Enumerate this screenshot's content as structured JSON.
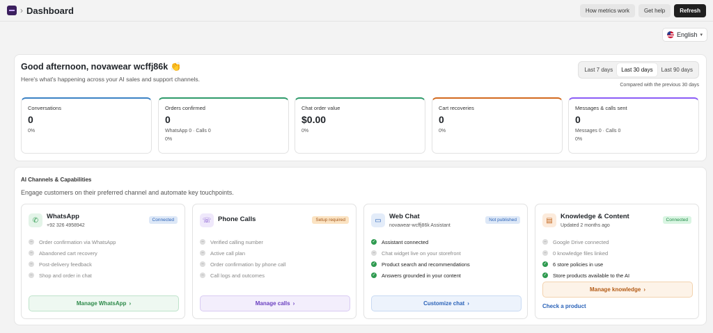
{
  "header": {
    "page_title": "Dashboard",
    "buttons": {
      "how": "How metrics work",
      "help": "Get help",
      "refresh": "Refresh"
    }
  },
  "language": {
    "label": "English"
  },
  "overview": {
    "greeting": "Good afternoon, novawear wcffj86k 👏",
    "subtitle": "Here's what's happening across your AI sales and support channels.",
    "ranges": [
      "Last 7 days",
      "Last 30 days",
      "Last 90 days"
    ],
    "active_range": "Last 30 days",
    "compared": "Compared with the previous 30 days",
    "metrics": [
      {
        "label": "Conversations",
        "value": "0",
        "sub1": "0%",
        "sub2": "",
        "color": "#3b82c4"
      },
      {
        "label": "Orders confirmed",
        "value": "0",
        "sub1": "WhatsApp 0 · Calls 0",
        "sub2": "0%",
        "color": "#2e9a6a"
      },
      {
        "label": "Chat order value",
        "value": "$0.00",
        "sub1": "0%",
        "sub2": "",
        "color": "#2e9a6a"
      },
      {
        "label": "Cart recoveries",
        "value": "0",
        "sub1": "0%",
        "sub2": "",
        "color": "#d2691e"
      },
      {
        "label": "Messages & calls sent",
        "value": "0",
        "sub1": "Messages 0 · Calls 0",
        "sub2": "0%",
        "color": "#8b5cf6"
      }
    ]
  },
  "channels": {
    "title": "AI Channels & Capabilities",
    "subtitle": "Engage customers on their preferred channel and automate key touchpoints.",
    "cards": [
      {
        "name": "WhatsApp",
        "sub": "+92 326 4958942",
        "badge": "Connected",
        "features": [
          {
            "text": "Order confirmation via WhatsApp",
            "on": false
          },
          {
            "text": "Abandoned cart recovery",
            "on": false
          },
          {
            "text": "Post-delivery feedback",
            "on": false
          },
          {
            "text": "Shop and order in chat",
            "on": false
          }
        ],
        "action": "Manage WhatsApp"
      },
      {
        "name": "Phone Calls",
        "sub": "",
        "badge": "Setup required",
        "features": [
          {
            "text": "Verified calling number",
            "on": false
          },
          {
            "text": "Active call plan",
            "on": false
          },
          {
            "text": "Order confirmation by phone call",
            "on": false
          },
          {
            "text": "Call logs and outcomes",
            "on": false
          }
        ],
        "action": "Manage calls"
      },
      {
        "name": "Web Chat",
        "sub": "novawear-wcffj86k Assistant",
        "badge": "Not published",
        "features": [
          {
            "text": "Assistant connected",
            "on": true
          },
          {
            "text": "Chat widget live on your storefront",
            "on": false
          },
          {
            "text": "Product search and recommendations",
            "on": true
          },
          {
            "text": "Answers grounded in your content",
            "on": true
          }
        ],
        "action": "Customize chat"
      },
      {
        "name": "Knowledge & Content",
        "sub": "Updated 2 months ago",
        "badge": "Connected",
        "features": [
          {
            "text": "Google Drive connected",
            "on": false
          },
          {
            "text": "0 knowledge files linked",
            "on": false
          },
          {
            "text": "6 store policies in use",
            "on": true
          },
          {
            "text": "Store products available to the AI",
            "on": true
          }
        ],
        "action": "Manage knowledge",
        "link": "Check a product"
      }
    ]
  }
}
